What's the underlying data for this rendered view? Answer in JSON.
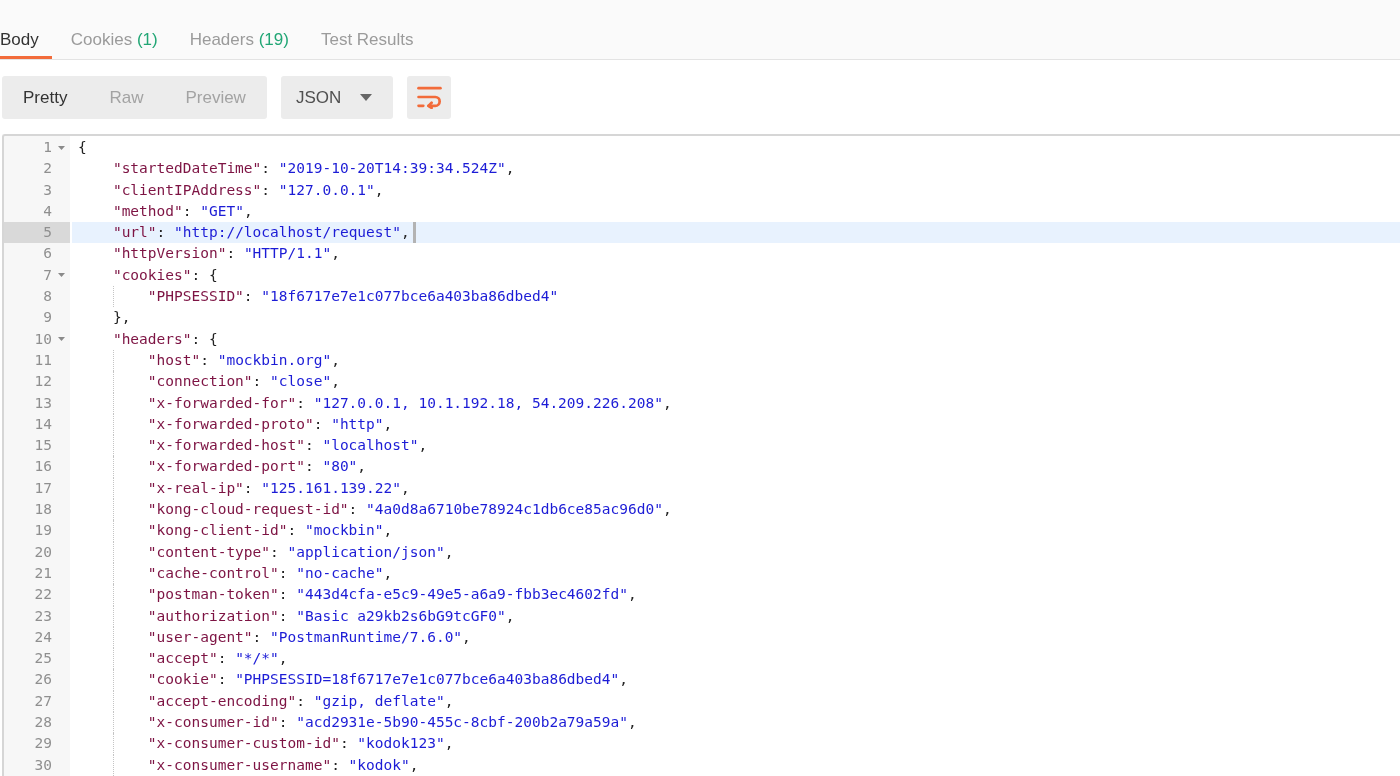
{
  "tabs": [
    {
      "label": "Body",
      "selected": true
    },
    {
      "label": "Cookies",
      "count": "(1)",
      "selected": false
    },
    {
      "label": "Headers",
      "count": "(19)",
      "selected": false
    },
    {
      "label": "Test Results",
      "selected": false
    }
  ],
  "view_modes": [
    {
      "label": "Pretty",
      "selected": true
    },
    {
      "label": "Raw",
      "selected": false
    },
    {
      "label": "Preview",
      "selected": false
    }
  ],
  "format_dropdown": {
    "value": "JSON"
  },
  "editor": {
    "lines": [
      {
        "number": "1",
        "text": "{",
        "selected": false,
        "children": [
          {
            "number": "2",
            "text": "\"startedDateTime\": \"2019-10-20T14:39:34.524Z\",",
            "selected": false
          },
          {
            "number": "3",
            "text": "\"clientIPAddress\": \"127.0.0.1\",",
            "selected": false
          },
          {
            "number": "4",
            "text": "\"method\": \"GET\",",
            "selected": false
          },
          {
            "number": "5",
            "text": "\"url\": \"http://localhost/request\",",
            "selected": true
          },
          {
            "number": "6",
            "text": "\"httpVersion\": \"HTTP/1.1\",",
            "selected": false
          },
          {
            "number": "7",
            "text": "\"cookies\": {",
            "selected": false,
            "children": [
              {
                "number": "8",
                "text": "\"PHPSESSID\": \"18f6717e7e1c077bce6a403ba86dbed4\"",
                "selected": false
              }
            ]
          },
          {
            "number": "9",
            "text": "},",
            "selected": false
          },
          {
            "number": "10",
            "text": "\"headers\": {",
            "selected": false,
            "children": [
              {
                "number": "11",
                "text": "\"host\": \"mockbin.org\",",
                "selected": false
              },
              {
                "number": "12",
                "text": "\"connection\": \"close\",",
                "selected": false
              },
              {
                "number": "13",
                "text": "\"x-forwarded-for\": \"127.0.0.1, 10.1.192.18, 54.209.226.208\",",
                "selected": false
              },
              {
                "number": "14",
                "text": "\"x-forwarded-proto\": \"http\",",
                "selected": false
              },
              {
                "number": "15",
                "text": "\"x-forwarded-host\": \"localhost\",",
                "selected": false
              },
              {
                "number": "16",
                "text": "\"x-forwarded-port\": \"80\",",
                "selected": false
              },
              {
                "number": "17",
                "text": "\"x-real-ip\": \"125.161.139.22\",",
                "selected": false
              },
              {
                "number": "18",
                "text": "\"kong-cloud-request-id\": \"4a0d8a6710be78924c1db6ce85ac96d0\",",
                "selected": false
              },
              {
                "number": "19",
                "text": "\"kong-client-id\": \"mockbin\",",
                "selected": false
              },
              {
                "number": "20",
                "text": "\"content-type\": \"application/json\",",
                "selected": false
              },
              {
                "number": "21",
                "text": "\"cache-control\": \"no-cache\",",
                "selected": false
              },
              {
                "number": "22",
                "text": "\"postman-token\": \"443d4cfa-e5c9-49e5-a6a9-fbb3ec4602fd\",",
                "selected": false
              },
              {
                "number": "23",
                "text": "\"authorization\": \"Basic a29kb2s6bG9tcGF0\",",
                "selected": false
              },
              {
                "number": "24",
                "text": "\"user-agent\": \"PostmanRuntime/7.6.0\",",
                "selected": false
              },
              {
                "number": "25",
                "text": "\"accept\": \"*/*\",",
                "selected": false
              },
              {
                "number": "26",
                "text": "\"cookie\": \"PHPSESSID=18f6717e7e1c077bce6a403ba86dbed4\",",
                "selected": false
              },
              {
                "number": "27",
                "text": "\"accept-encoding\": \"gzip, deflate\",",
                "selected": false
              },
              {
                "number": "28",
                "text": "\"x-consumer-id\": \"acd2931e-5b90-455c-8cbf-200b2a79a59a\",",
                "selected": false
              },
              {
                "number": "29",
                "text": "\"x-consumer-custom-id\": \"kodok123\",",
                "selected": false
              },
              {
                "number": "30",
                "text": "\"x-consumer-username\": \"kodok\",",
                "selected": false
              }
            ]
          }
        ]
      }
    ]
  }
}
